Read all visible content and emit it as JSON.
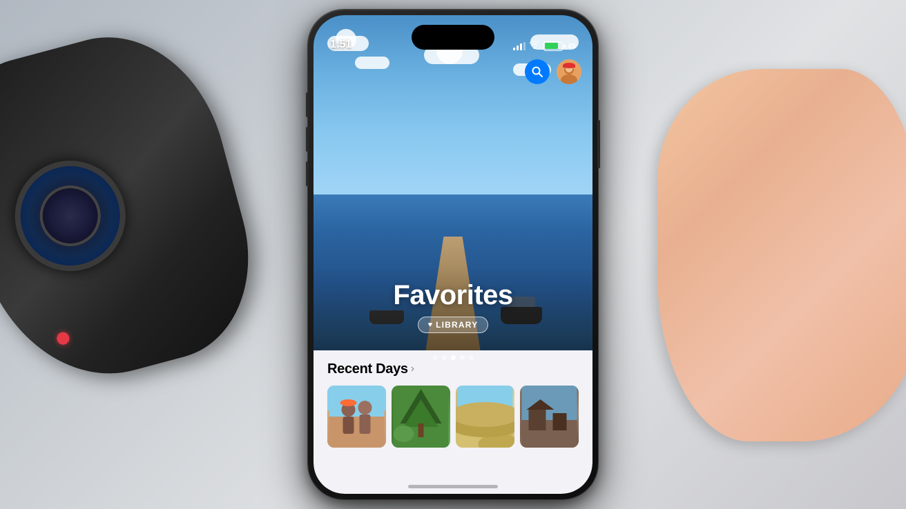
{
  "background": {
    "color": "#c8c8c8"
  },
  "phone": {
    "status_bar": {
      "time": "1:51",
      "battery_percent": "45"
    },
    "photo": {
      "title": "Favorites",
      "badge_label": "LIBRARY",
      "badge_icon": "♥"
    },
    "page_dots": {
      "count": 5,
      "active_index": 2
    },
    "bottom": {
      "recent_days_label": "Recent Days",
      "chevron": "›"
    },
    "top_actions": {
      "search_icon": "🔍",
      "avatar_icon": "👤"
    }
  }
}
